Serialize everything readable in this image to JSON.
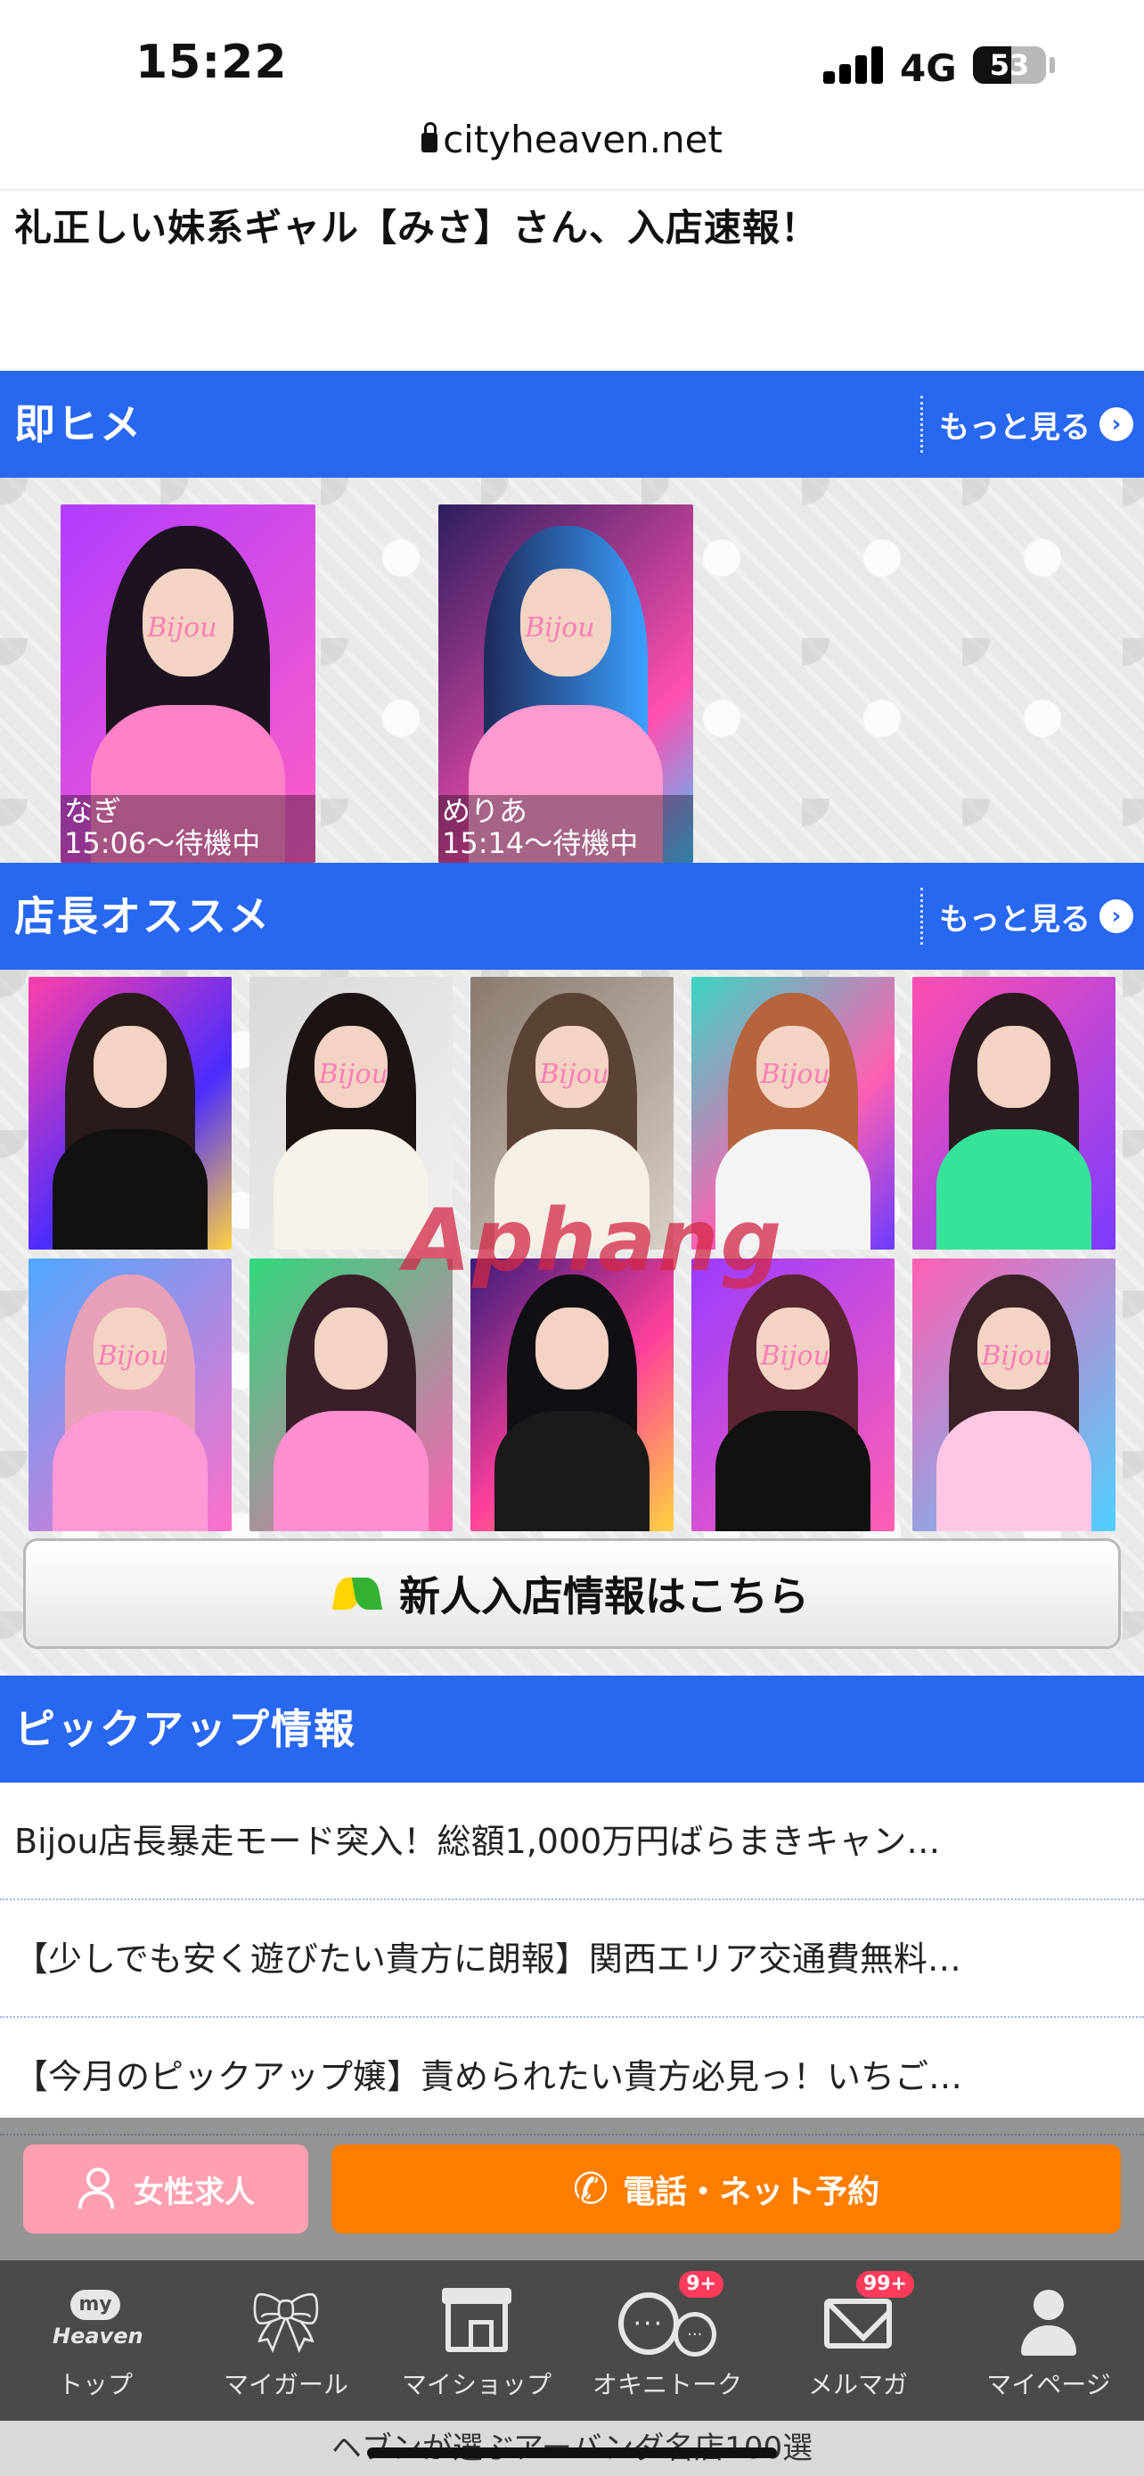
{
  "status_bar": {
    "time": "15:22",
    "network": "4G",
    "battery": "53",
    "battery_level": 0.53
  },
  "browser": {
    "url": "cityheaven.net"
  },
  "headline": "礼正しい妹系ギャル【みさ】さん、入店速報！",
  "section_instant": {
    "title": "即ヒメ",
    "more_label": "もっと見る",
    "cards": [
      {
        "name": "なぎ",
        "status": "15:06〜待機中"
      },
      {
        "name": "めりあ",
        "status": "15:14〜待機中"
      }
    ]
  },
  "section_recommend": {
    "title": "店長オススメ",
    "more_label": "もっと見る"
  },
  "photo_watermark": "Bijou",
  "brand_overlay": "Aphang",
  "new_arrival_button": "新人入店情報はこちら",
  "section_pickup": {
    "title": "ピックアップ情報",
    "items": [
      "Bijou店長暴走モード突入！総額1,000万円ばらまきキャン…",
      "【少しでも安く遊びたい貴方に朗報】関西エリア交通費無料…",
      "【今月のピックアップ嬢】責められたい貴方必見っ！いちご…"
    ]
  },
  "action_bar": {
    "recruit_label": "女性求人",
    "reserve_label": "電話・ネット予約"
  },
  "tab_bar": {
    "tabs": [
      {
        "label": "トップ",
        "icon": "my-heaven-icon",
        "badge": ""
      },
      {
        "label": "マイガール",
        "icon": "bow-icon",
        "badge": ""
      },
      {
        "label": "マイショップ",
        "icon": "shop-icon",
        "badge": ""
      },
      {
        "label": "オキニトーク",
        "icon": "chat-icon",
        "badge": "9+"
      },
      {
        "label": "メルマガ",
        "icon": "mail-icon",
        "badge": "99+"
      },
      {
        "label": "マイページ",
        "icon": "user-icon",
        "badge": ""
      }
    ],
    "my_heaven_pill": "my",
    "my_heaven_word": "Heaven"
  },
  "footer_text": "ヘブンが選ぶアーバンダ名店100選",
  "colors": {
    "section_blue": "#2867f0",
    "reserve_orange": "#ff7e00",
    "recruit_pink": "#ff9fb0",
    "tabbar_gray": "#4a4a4a"
  }
}
